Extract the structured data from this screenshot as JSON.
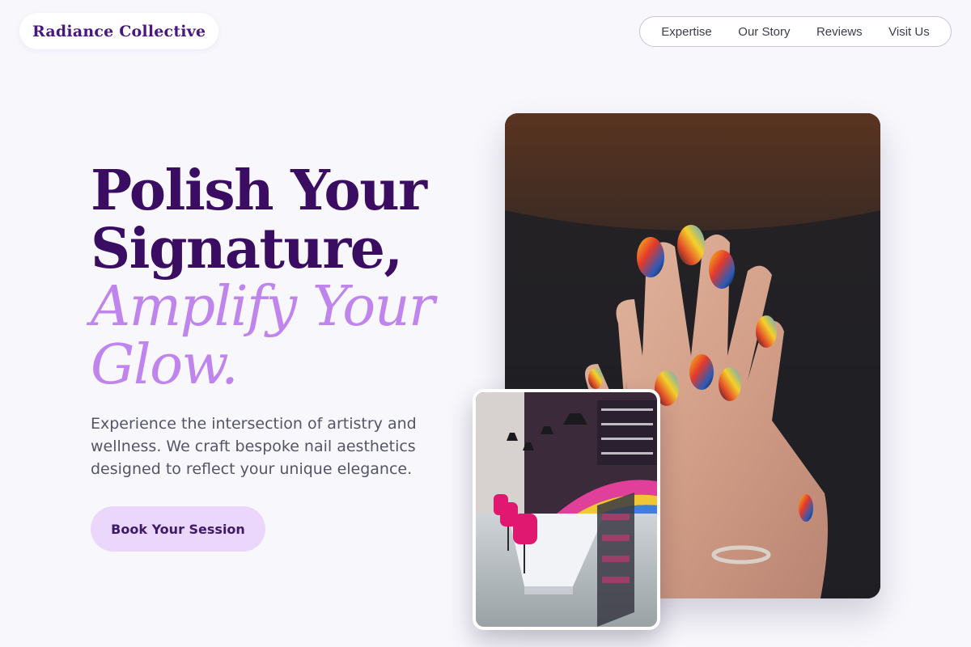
{
  "brand": {
    "name": "Radiance Collective"
  },
  "nav": {
    "items": [
      {
        "label": "Expertise"
      },
      {
        "label": "Our Story"
      },
      {
        "label": "Reviews"
      },
      {
        "label": "Visit Us"
      }
    ]
  },
  "hero": {
    "headline_line1": "Polish Your",
    "headline_line2": "Signature,",
    "headline_line3": "Amplify Your",
    "headline_line4": "Glow.",
    "subtitle": "Experience the intersection of artistry and wellness. We craft bespoke nail aesthetics designed to reflect your unique elegance.",
    "cta_label": "Book Your Session"
  },
  "colors": {
    "page_background": "#f7f7fc",
    "brand_purple": "#4a1780",
    "headline_dark": "#3a0d62",
    "headline_accent": "#c085ec",
    "cta_background": "#ead7fb",
    "nav_border": "#cdbfe3"
  },
  "images": {
    "main": "photo-hands-nail-art",
    "inset": "photo-salon-interior"
  }
}
